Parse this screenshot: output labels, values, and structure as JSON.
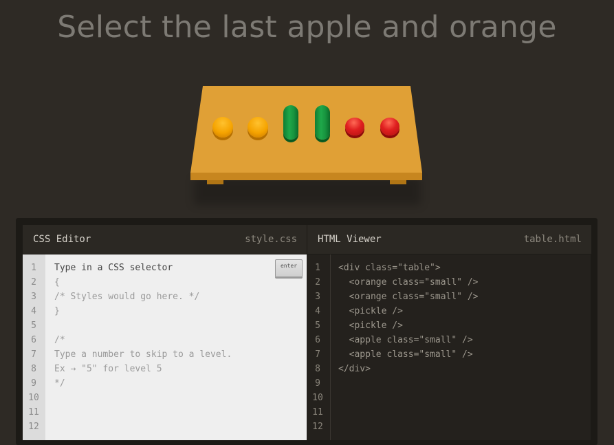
{
  "title": "Select the last apple and orange",
  "table": {
    "items": [
      {
        "kind": "orange"
      },
      {
        "kind": "orange"
      },
      {
        "kind": "pickle"
      },
      {
        "kind": "pickle"
      },
      {
        "kind": "apple"
      },
      {
        "kind": "apple"
      }
    ],
    "colors": {
      "top": "#e8a93a",
      "front": "#c98a22",
      "legs": "#b07515"
    }
  },
  "css_editor": {
    "name": "CSS Editor",
    "file": "style.css",
    "enter_label": "enter",
    "line_numbers": [
      "1",
      "2",
      "3",
      "4",
      "5",
      "6",
      "7",
      "8",
      "9",
      "10",
      "11",
      "12"
    ],
    "lines": [
      "Type in a CSS selector",
      "{",
      "/* Styles would go here. */",
      "}",
      "",
      "/*",
      "Type a number to skip to a level.",
      "Ex → \"5\" for level 5",
      "*/",
      "",
      "",
      ""
    ]
  },
  "html_viewer": {
    "name": "HTML Viewer",
    "file": "table.html",
    "line_numbers": [
      "1",
      "2",
      "3",
      "4",
      "5",
      "6",
      "7",
      "8",
      "9",
      "10",
      "11",
      "12"
    ],
    "lines": [
      "<div class=\"table\">",
      "  <orange class=\"small\" />",
      "  <orange class=\"small\" />",
      "  <pickle />",
      "  <pickle />",
      "  <apple class=\"small\" />",
      "  <apple class=\"small\" />",
      "</div>",
      "",
      "",
      "",
      ""
    ]
  }
}
